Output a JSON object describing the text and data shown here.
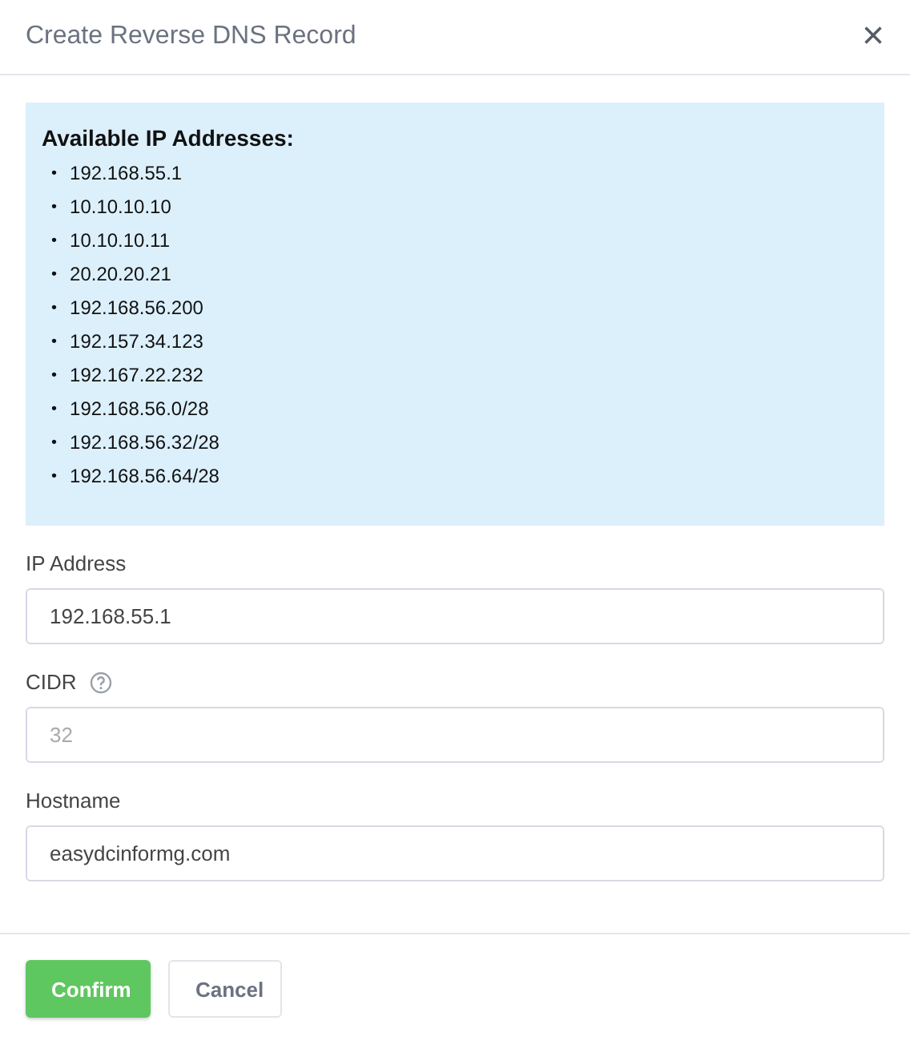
{
  "dialog": {
    "title": "Create Reverse DNS Record",
    "close": "×"
  },
  "info": {
    "heading": "Available IP Addresses:",
    "bullet": "•",
    "items": [
      "192.168.55.1",
      "10.10.10.10",
      "10.10.10.11",
      "20.20.20.21",
      "192.168.56.200",
      "192.157.34.123",
      "192.167.22.232",
      "192.168.56.0/28",
      "192.168.56.32/28",
      "192.168.56.64/28"
    ]
  },
  "fields": [
    {
      "label": "IP Address",
      "value": "192.168.55.1",
      "help": false
    },
    {
      "label": "CIDR",
      "placeholder": "32",
      "help": true
    },
    {
      "label": "Hostname",
      "value": "easydcinformg.com",
      "help": false
    }
  ],
  "buttons": [
    {
      "label": "Confirm",
      "kind": "primary"
    },
    {
      "label": "Cancel",
      "kind": "secondary"
    }
  ]
}
